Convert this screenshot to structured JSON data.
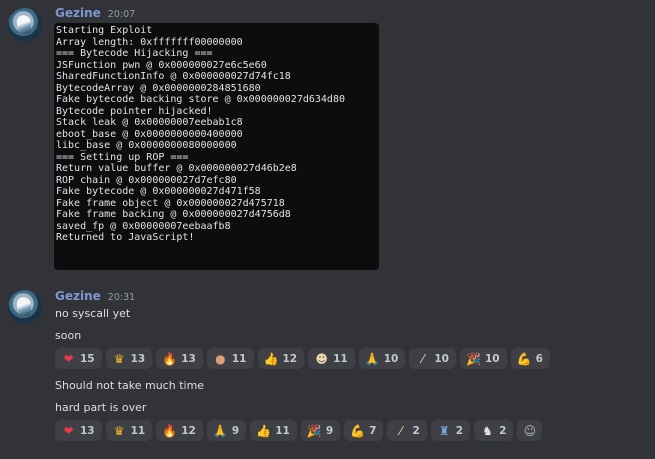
{
  "message1": {
    "username": "Gezine",
    "timestamp": "20:07",
    "code_lines": [
      "Starting Exploit",
      "Array length: 0xfffffff00000000",
      "=== Bytecode Hijacking ===",
      "JSFunction pwn @ 0x000000027e6c5e60",
      "SharedFunctionInfo @ 0x000000027d74fc18",
      "BytecodeArray @ 0x0000000284851680",
      "Fake bytecode backing store @ 0x000000027d634d80",
      "Bytecode pointer hijacked!",
      "Stack leak @ 0x00000007eebab1c8",
      "eboot_base @ 0x0000000000400000",
      "libc_base @ 0x0000000080000000",
      "=== Setting up ROP ===",
      "Return value buffer @ 0x000000027d46b2e8",
      "ROP chain @ 0x000000027d7efc80",
      "Fake bytecode @ 0x000000027d471f58",
      "Fake frame object @ 0x000000027d475718",
      "Fake frame backing @ 0x000000027d4756d8",
      "saved_fp @ 0x00000007eebaafb8",
      "Returned to JavaScript!"
    ]
  },
  "message2": {
    "username": "Gezine",
    "timestamp": "20:31",
    "line1": "no syscall yet",
    "line2": "soon",
    "reactions1": [
      {
        "emoji": "❤",
        "icon": "heart-icon",
        "count": "15",
        "color": "#e8394a"
      },
      {
        "emoji": "♛",
        "icon": "crown-icon",
        "count": "13",
        "color": "#f5b623"
      },
      {
        "emoji": "🔥",
        "icon": "fire-icon",
        "count": "13",
        "color": "#f4782a"
      },
      {
        "emoji": "●",
        "icon": "brown-circle-icon",
        "count": "11",
        "color": "#d9a07a"
      },
      {
        "emoji": "👍",
        "icon": "thumbs-up-icon",
        "count": "12",
        "color": "#f7c83a"
      },
      {
        "emoji": "☻",
        "icon": "cook-icon",
        "count": "11",
        "color": "#f0d9b0"
      },
      {
        "emoji": "🙏",
        "icon": "folded-hands-icon",
        "count": "10",
        "color": "#f7c83a"
      },
      {
        "emoji": "⁄",
        "icon": "magic-wand-icon",
        "count": "10",
        "color": "#e8d7a8"
      },
      {
        "emoji": "🎉",
        "icon": "party-popper-icon",
        "count": "10",
        "color": "#f06a4b"
      },
      {
        "emoji": "💪",
        "icon": "flexed-biceps-icon",
        "count": "6",
        "color": "#f7c83a"
      }
    ],
    "line3": "Should not take much time",
    "line4": "hard part is over",
    "reactions2": [
      {
        "emoji": "❤",
        "icon": "heart-icon",
        "count": "13",
        "color": "#e8394a"
      },
      {
        "emoji": "♛",
        "icon": "crown-icon",
        "count": "11",
        "color": "#f5b623"
      },
      {
        "emoji": "🔥",
        "icon": "fire-icon",
        "count": "12",
        "color": "#f4782a"
      },
      {
        "emoji": "🙏",
        "icon": "folded-hands-icon",
        "count": "9",
        "color": "#f7c83a"
      },
      {
        "emoji": "👍",
        "icon": "thumbs-up-icon",
        "count": "11",
        "color": "#f7c83a"
      },
      {
        "emoji": "🎉",
        "icon": "party-popper-icon",
        "count": "9",
        "color": "#f06a4b"
      },
      {
        "emoji": "💪",
        "icon": "flexed-biceps-icon",
        "count": "7",
        "color": "#f7c83a"
      },
      {
        "emoji": "⁄",
        "icon": "magic-wand-icon",
        "count": "2",
        "color": "#e8d7a8"
      },
      {
        "emoji": "♜",
        "icon": "mage-icon",
        "count": "2",
        "color": "#7fa7e0"
      },
      {
        "emoji": "♞",
        "icon": "goat-icon",
        "count": "2",
        "color": "#e8e6e0"
      }
    ],
    "add_reaction_icon": "add-reaction-smiley-icon"
  }
}
